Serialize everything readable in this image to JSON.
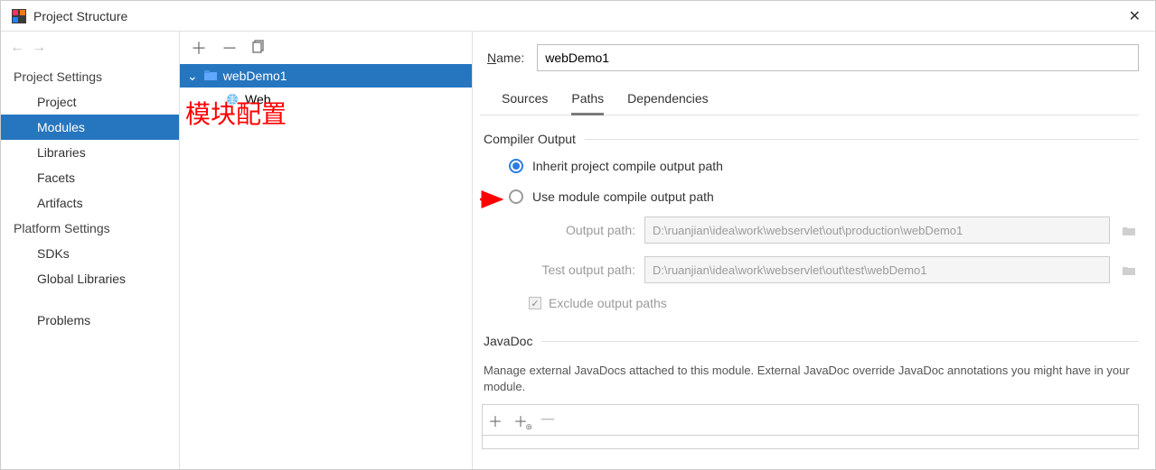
{
  "window": {
    "title": "Project Structure"
  },
  "leftnav": {
    "sections": [
      {
        "title": "Project Settings",
        "items": [
          "Project",
          "Modules",
          "Libraries",
          "Facets",
          "Artifacts"
        ],
        "selected": "Modules"
      },
      {
        "title": "Platform Settings",
        "items": [
          "SDKs",
          "Global Libraries"
        ]
      },
      {
        "title": "",
        "items": [
          "Problems"
        ]
      }
    ]
  },
  "tree": {
    "root": {
      "name": "webDemo1",
      "expanded": true,
      "selected": true
    },
    "children": [
      {
        "name": "Web"
      }
    ]
  },
  "annotation_text": "模块配置",
  "right": {
    "name_label": "Name:",
    "name_value": "webDemo1",
    "tabs": [
      "Sources",
      "Paths",
      "Dependencies"
    ],
    "active_tab": "Paths",
    "compiler_output": {
      "section_title": "Compiler Output",
      "radio_inherit": "Inherit project compile output path",
      "radio_module": "Use module compile output path",
      "selected_radio": "inherit",
      "output_path_label": "Output path:",
      "output_path_value": "D:\\ruanjian\\idea\\work\\webservlet\\out\\production\\webDemo1",
      "test_output_path_label": "Test output path:",
      "test_output_path_value": "D:\\ruanjian\\idea\\work\\webservlet\\out\\test\\webDemo1",
      "exclude_label": "Exclude output paths",
      "exclude_checked": true
    },
    "javadoc": {
      "section_title": "JavaDoc",
      "description": "Manage external JavaDocs attached to this module. External JavaDoc override JavaDoc annotations you might have in your module."
    }
  }
}
